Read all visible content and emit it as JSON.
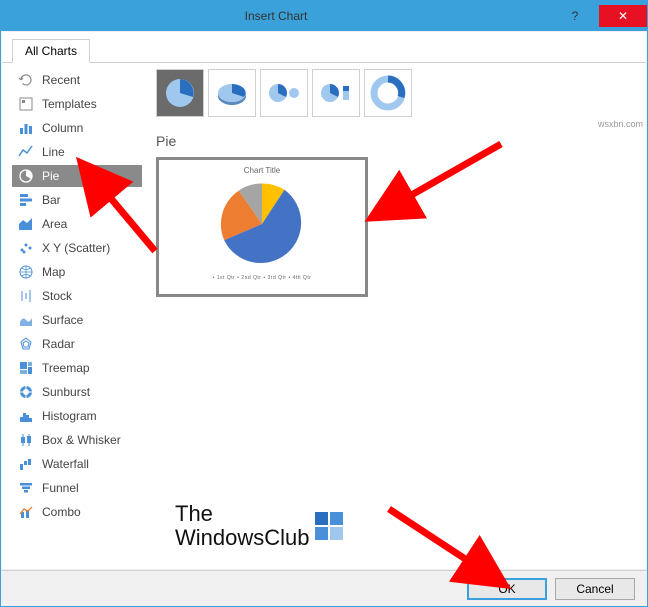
{
  "title": "Insert Chart",
  "tabs": {
    "all_charts": "All Charts"
  },
  "sidebar": {
    "items": [
      {
        "label": "Recent"
      },
      {
        "label": "Templates"
      },
      {
        "label": "Column"
      },
      {
        "label": "Line"
      },
      {
        "label": "Pie"
      },
      {
        "label": "Bar"
      },
      {
        "label": "Area"
      },
      {
        "label": "X Y (Scatter)"
      },
      {
        "label": "Map"
      },
      {
        "label": "Stock"
      },
      {
        "label": "Surface"
      },
      {
        "label": "Radar"
      },
      {
        "label": "Treemap"
      },
      {
        "label": "Sunburst"
      },
      {
        "label": "Histogram"
      },
      {
        "label": "Box & Whisker"
      },
      {
        "label": "Waterfall"
      },
      {
        "label": "Funnel"
      },
      {
        "label": "Combo"
      }
    ]
  },
  "subtype_label": "Pie",
  "preview": {
    "title": "Chart Title",
    "legend": "• 1st Qtr   • 2nd Qtr   • 3rd Qtr   • 4th Qtr"
  },
  "buttons": {
    "ok": "OK",
    "cancel": "Cancel"
  },
  "watermark": {
    "line1": "The",
    "line2": "WindowsClub"
  },
  "source_url": "wsxbn.com",
  "chart_data": {
    "type": "pie",
    "title": "Chart Title",
    "categories": [
      "1st Qtr",
      "2nd Qtr",
      "3rd Qtr",
      "4th Qtr"
    ],
    "values": [
      58,
      23,
      10,
      9
    ],
    "colors": [
      "#4472c4",
      "#ed7d31",
      "#a5a5a5",
      "#ffc000"
    ]
  }
}
